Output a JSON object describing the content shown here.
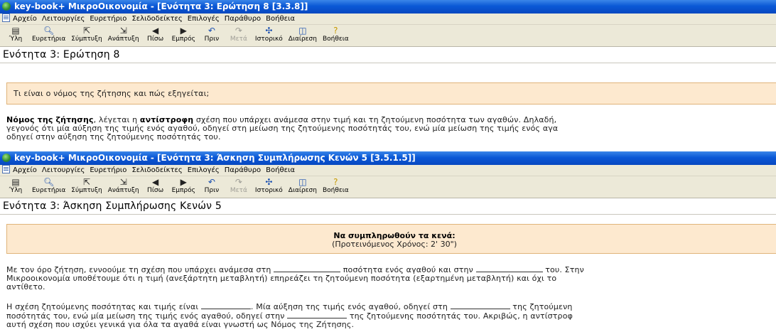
{
  "window1": {
    "title": "key-book+   ΜικροΟικονομία - [Ενότητα 3: Ερώτηση 8   [3.3.8]]",
    "heading": "Ενότητα 3: Ερώτηση 8",
    "question": "Τι είναι ο νόμος της ζήτησης και πώς εξηγείται;",
    "answer": {
      "term": "Νόμος της ζήτησης",
      "part1": ", λέγεται η ",
      "emph": "αντίστροφη",
      "line1_rest": " σχέση που υπάρχει ανάμεσα στην τιμή και τη ζητούμενη ποσότητα των αγαθών. Δηλαδή,",
      "line2": "γεγονός ότι μία αύξηση της τιμής ενός αγαθού, οδηγεί στη μείωση της ζητούμενης ποσότητάς του, ενώ μία μείωση της τιμής ενός αγα",
      "line3": "οδηγεί στην αύξηση της ζητούμενης ποσότητάς του."
    }
  },
  "window2": {
    "title": "key-book+   ΜικροΟικονομία - [Ενότητα 3: Άσκηση Συμπλήρωσης Κενών 5   [3.5.1.5]]",
    "heading": "Ενότητα 3: Άσκηση Συμπλήρωσης Κενών 5",
    "instruction_title": "Να συμπληρωθούν τα κενά:",
    "instruction_sub": "(Προτεινόμενος Χρόνος: 2' 30\")",
    "p1": {
      "a": "Με τον όρο ζήτηση, εννοούμε τη σχέση που υπάρχει ανάμεσα στη ",
      "b": " ποσότητα ενός αγαθού και στην ",
      "c": " του. Στην",
      "line2": "Μικροοικονομία υποθέτουμε ότι η τιμή (ανεξάρτητη μεταβλητή) επηρεάζει τη ζητούμενη ποσότητα (εξαρτημένη μεταβλητή) και όχι το",
      "line3": "αντίθετο."
    },
    "p2": {
      "a": "Η σχέση ζητούμενης ποσότητας και τιμής είναι ",
      "b": ". Μία αύξηση της τιμής ενός αγαθού, οδηγεί στη ",
      "c": " της ζητούμενη",
      "d": "ποσότητάς του, ενώ μία μείωση της τιμής ενός αγαθού, οδηγεί στην ",
      "e": " της ζητούμενης ποσότητάς του. Ακριβώς, η αντίστροφ",
      "line3": "αυτή σχέση που ισχύει γενικά για όλα τα αγαθά είναι γνωστή ως Νόμος της Ζήτησης."
    }
  },
  "menu": [
    "Αρχείο",
    "Λειτουργίες",
    "Ευρετήριο",
    "Σελιδοδείκτες",
    "Επιλογές",
    "Παράθυρο",
    "Βοήθεια"
  ],
  "toolbar": [
    {
      "label": "Ύλη",
      "icon": "book-icon",
      "glyph": "▤"
    },
    {
      "label": "Ευρετήρια",
      "icon": "search-icon",
      "glyph": "🔍"
    },
    {
      "label": "Σύμπτυξη",
      "icon": "collapse-icon",
      "glyph": "⇱"
    },
    {
      "label": "Ανάπτυξη",
      "icon": "expand-icon",
      "glyph": "⇲"
    },
    {
      "label": "Πίσω",
      "icon": "back-arrow-icon",
      "glyph": "◀"
    },
    {
      "label": "Εμπρός",
      "icon": "forward-arrow-icon",
      "glyph": "▶"
    },
    {
      "label": "Πριν",
      "icon": "undo-icon",
      "glyph": "↶"
    },
    {
      "label": "Μετά",
      "icon": "redo-icon",
      "glyph": "↷"
    },
    {
      "label": "Ιστορικό",
      "icon": "history-icon",
      "glyph": "✣"
    },
    {
      "label": "Διαίρεση",
      "icon": "split-window-icon",
      "glyph": "◫"
    },
    {
      "label": "Βοήθεια",
      "icon": "help-icon",
      "glyph": "?"
    }
  ],
  "colors": {
    "titlebar": "#0a58d6",
    "chrome": "#ece9d8",
    "question_box": "#fde9cf",
    "question_border": "#e0b47a"
  }
}
